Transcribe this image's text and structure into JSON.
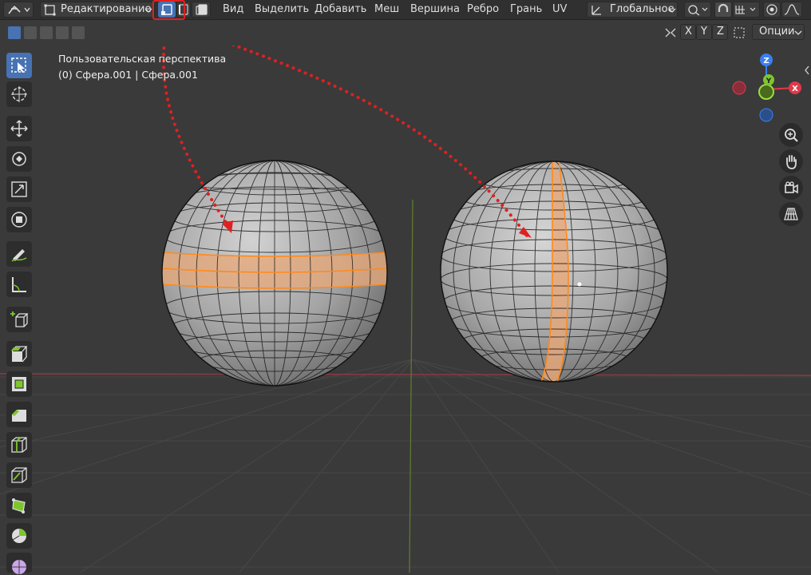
{
  "header": {
    "mode_label": "Редактирование",
    "menus": [
      "Вид",
      "Выделить",
      "Добавить",
      "Меш",
      "Вершина",
      "Ребро",
      "Грань",
      "UV"
    ],
    "orientation_label": "Глобальное"
  },
  "toolbar2": {
    "axis_x": "X",
    "axis_y": "Y",
    "axis_z": "Z",
    "options_label": "Опции"
  },
  "overlay": {
    "view_name": "Пользовательская перспектива",
    "object_info": "(0) Сфера.001 | Сфера.001"
  },
  "gizmo": {
    "z": "Z",
    "y": "Y",
    "x": "X"
  },
  "colors": {
    "selection_orange": "#ff8a1a",
    "highlight_red": "#e02020",
    "axis_red": "#e0394b",
    "axis_green": "#7ec62e",
    "axis_blue": "#3b7ff0",
    "active_tool": "#4772b3"
  }
}
